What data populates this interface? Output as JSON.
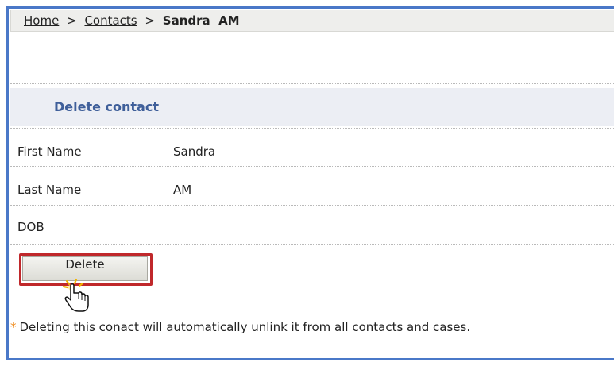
{
  "breadcrumb": {
    "home": "Home",
    "sep1": ">",
    "contacts": "Contacts",
    "sep2": ">",
    "current": "Sandra  AM"
  },
  "section": {
    "title": "Delete contact"
  },
  "fields": [
    {
      "label": "First Name",
      "value": "Sandra"
    },
    {
      "label": "Last Name",
      "value": "AM"
    },
    {
      "label": "DOB",
      "value": ""
    }
  ],
  "actions": {
    "delete_label": "Delete"
  },
  "note": {
    "star": "*",
    "text": "Deleting this conact will automatically unlink it from all contacts and cases."
  },
  "colors": {
    "frame_border": "#4a78c8",
    "section_title": "#3f5f9a",
    "highlight_outline": "#c0282b",
    "note_star": "#ee8a1c"
  },
  "icons": {
    "cursor": "hand-pointer-click-icon"
  }
}
